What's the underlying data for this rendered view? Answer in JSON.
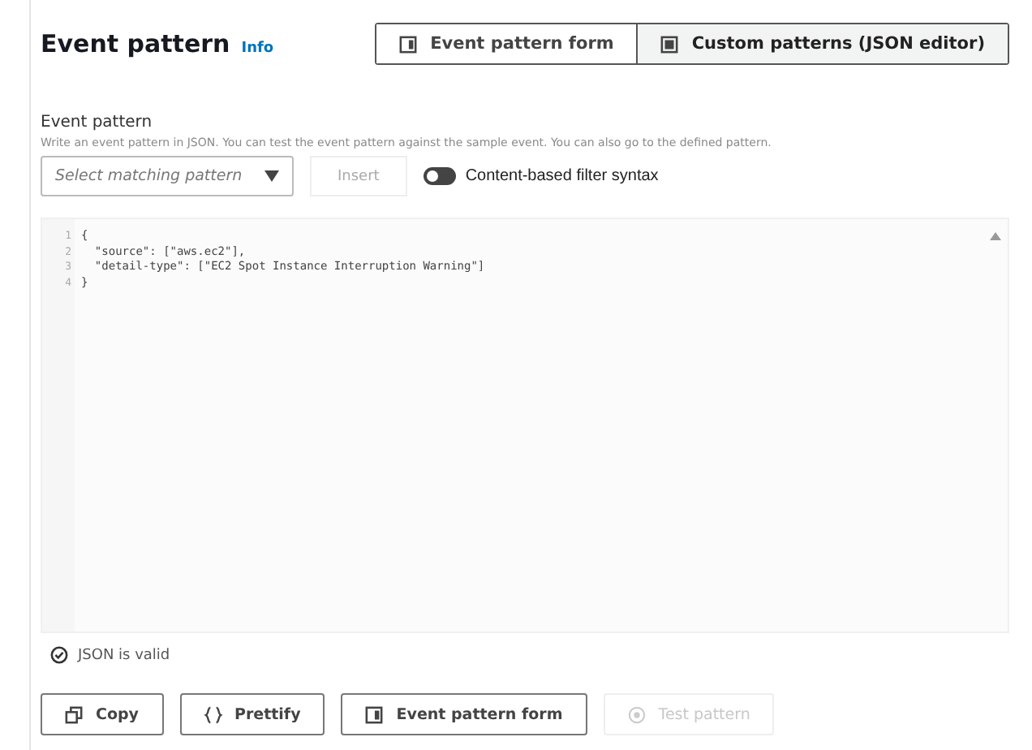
{
  "header": {
    "title": "Event pattern",
    "info_link": "Info"
  },
  "segments": [
    {
      "label": "Event pattern form",
      "kind": "form",
      "selected": false
    },
    {
      "label": "Custom patterns (JSON editor)",
      "kind": "json",
      "selected": true
    }
  ],
  "field": {
    "label": "Event pattern",
    "description": "Write an event pattern in JSON. You can test the event pattern against the sample event. You can also go to the defined pattern."
  },
  "pattern_select": {
    "placeholder": "Select matching pattern"
  },
  "insert_button": {
    "label": "Insert",
    "disabled": true
  },
  "filter_toggle": {
    "label": "Content-based filter syntax",
    "on": false
  },
  "editor": {
    "lines": [
      {
        "number": "1",
        "code": "{"
      },
      {
        "number": "2",
        "code": "  \"source\": [\"aws.ec2\"],"
      },
      {
        "number": "3",
        "code": "  \"detail-type\": [\"EC2 Spot Instance Interruption Warning\"]"
      },
      {
        "number": "4",
        "code": "}"
      }
    ],
    "validation": {
      "text": "JSON is valid",
      "valid": true
    }
  },
  "actions": [
    {
      "label": "Copy",
      "kind": "copy",
      "disabled": false
    },
    {
      "label": "Prettify",
      "kind": "braces",
      "disabled": false
    },
    {
      "label": "Event pattern form",
      "kind": "form",
      "disabled": false
    },
    {
      "label": "Test pattern",
      "kind": "test",
      "disabled": true
    }
  ]
}
